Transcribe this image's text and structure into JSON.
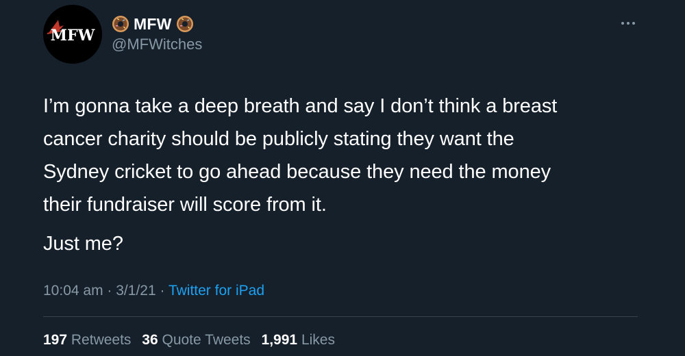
{
  "author": {
    "display_name": "MFW",
    "handle": "@MFWitches",
    "avatar_text": "MFW",
    "name_emoji_icon": "donut-icon"
  },
  "menu_icon": "more-horizontal-icon",
  "tweet": {
    "paragraphs": [
      {
        "lines": [
          "I’m gonna take a deep breath and say I don’t think a breast",
          "cancer charity should be publicly stating they want the",
          "Sydney cricket to go ahead because they need the money",
          "their fundraiser will score from it."
        ]
      },
      {
        "lines": [
          "Just me?"
        ]
      }
    ]
  },
  "meta": {
    "time": "10:04 am",
    "separator": "·",
    "date": "3/1/21",
    "source": "Twitter for iPad"
  },
  "stats": {
    "retweets_count": "197",
    "retweets_label": "Retweets",
    "quotes_count": "36",
    "quotes_label": "Quote Tweets",
    "likes_count": "1,991",
    "likes_label": "Likes"
  },
  "colors": {
    "background": "#15202b",
    "text": "#ffffff",
    "secondary_text": "#8899a6",
    "link": "#1da1f2",
    "divider": "#38444d"
  }
}
